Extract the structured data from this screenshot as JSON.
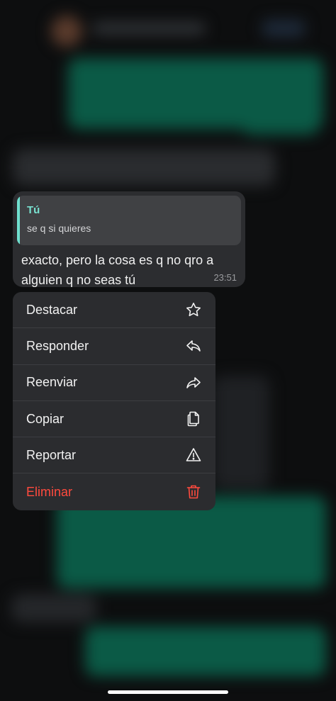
{
  "message": {
    "quote_author": "Tú",
    "quote_text": "se q si quieres",
    "text": "exacto, pero la cosa es q no qro a alguien q no seas tú",
    "time": "23:51"
  },
  "menu": {
    "items": [
      {
        "label": "Destacar",
        "icon": "star-icon"
      },
      {
        "label": "Responder",
        "icon": "reply-icon"
      },
      {
        "label": "Reenviar",
        "icon": "forward-icon"
      },
      {
        "label": "Copiar",
        "icon": "copy-icon"
      },
      {
        "label": "Reportar",
        "icon": "warning-icon"
      },
      {
        "label": "Eliminar",
        "icon": "trash-icon"
      }
    ]
  },
  "colors": {
    "accent_quote": "#79e2d1",
    "danger": "#ff4a3e",
    "bubble": "#2c2d30",
    "menu": "#2b2c2f"
  }
}
